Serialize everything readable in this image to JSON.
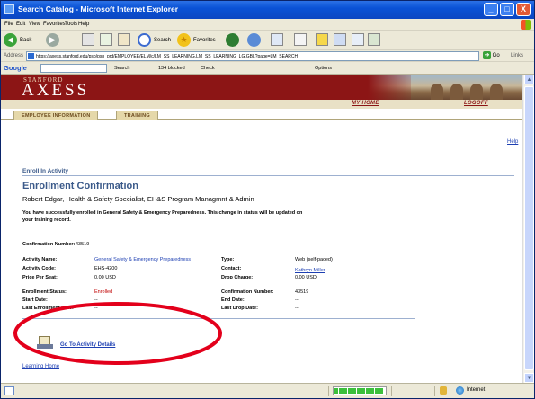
{
  "window": {
    "title": "Search Catalog - Microsoft Internet Explorer",
    "controls": [
      "_",
      "□",
      "X"
    ]
  },
  "menu": [
    "File",
    "Edit",
    "View",
    "Favorites",
    "Tools",
    "Help"
  ],
  "toolbar": {
    "back": "Back",
    "search": "Search",
    "favorites": "Favorites"
  },
  "address": {
    "label": "Address",
    "url": "https://axess.stanford.edu/psp/psp_prd/EMPLOYEE/ELM/c/LM_SS_LEARNING.LM_SS_LEARNING_LG.GBL?page=LM_SEARCH",
    "go": "Go",
    "links": "Links"
  },
  "google_toolbar": {
    "logo": "Google",
    "search": "Search",
    "blocked": "134 blocked",
    "check": "Check",
    "options": "Options"
  },
  "banner": {
    "small": "STANFORD",
    "big": "AXESS",
    "my_home": "MY HOME",
    "logoff": "LOGOFF"
  },
  "tabs": {
    "employee": "EMPLOYEE INFORMATION",
    "training": "TRAINING"
  },
  "page": {
    "help": "Help",
    "breadcrumb": "Enroll In Activity",
    "title": "Enrollment Confirmation",
    "person": "Robert Edgar, Health & Safety Specialist, EH&S Program Managmnt & Admin",
    "message": "You have successfully enrolled in General Safety & Emergency Preparedness. This change in status will be updated on your training record.",
    "confirmation_label": "Confirmation Number:",
    "confirmation_value": "43519",
    "activity_name_label": "Activity Name:",
    "activity_name_value": "General Safety & Emergency Preparedness",
    "type_label": "Type:",
    "type_value": "Web (self-paced)",
    "activity_code_label": "Activity Code:",
    "activity_code_value": "EHS-4200",
    "contact_label": "Contact:",
    "contact_value": "Kathryn Miller",
    "price_label": "Price Per Seat:",
    "price_value": "0.00 USD",
    "drop_charge_label": "Drop Charge:",
    "drop_charge_value": "0.00 USD",
    "enroll_status_label": "Enrollment Status:",
    "enroll_status_value": "Enrolled",
    "confirmation2_label": "Confirmation Number:",
    "confirmation2_value": "43519",
    "start_date_label": "Start Date:",
    "start_date_value": "--",
    "end_date_label": "End Date:",
    "end_date_value": "--",
    "last_enroll_label": "Last Enrollment Date:",
    "last_enroll_value": "--",
    "last_drop_label": "Last Drop Date:",
    "last_drop_value": "--",
    "go_to_details": "Go To Activity Details",
    "learning_home": "Learning Home"
  },
  "status": {
    "zone": "Internet"
  },
  "colors": {
    "stanford_red": "#8c1515",
    "title_blue": "#3b5a8a",
    "link_blue": "#1d3fb2",
    "annotation_red": "#e3001b"
  }
}
